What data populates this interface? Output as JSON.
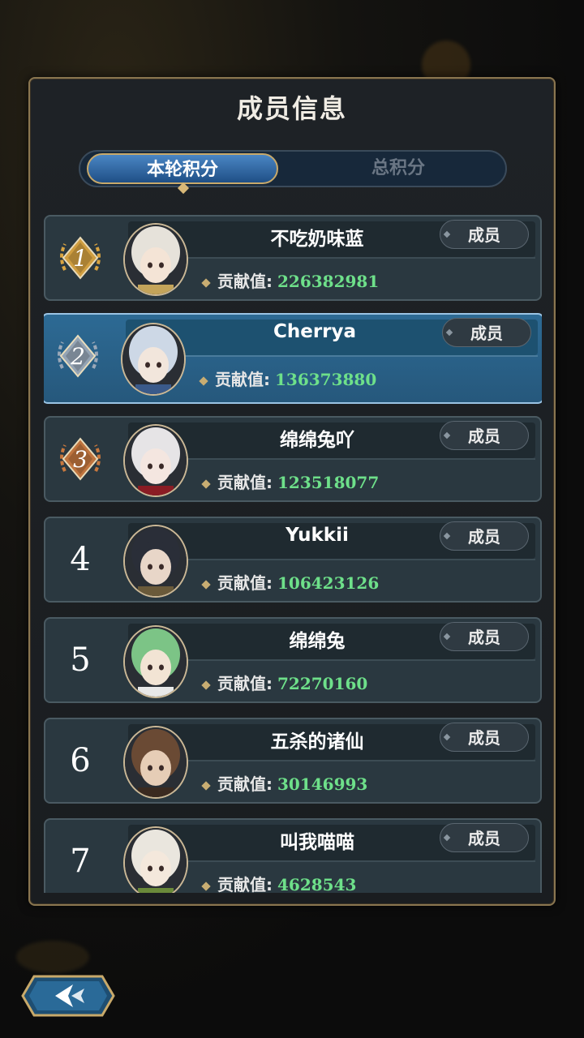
{
  "title": "成员信息",
  "tabs": [
    {
      "label": "本轮积分",
      "active": true
    },
    {
      "label": "总积分",
      "active": false
    }
  ],
  "contrib_label": "贡献值:",
  "members": [
    {
      "rank": "1",
      "name": "不吃奶味蓝",
      "role": "成员",
      "contribution": "226382981",
      "medal": "gold",
      "hair": "#e6e2da",
      "skin": "#f4e4d6",
      "accent": "#c4a45a"
    },
    {
      "rank": "2",
      "name": "Cherrya",
      "role": "成员",
      "contribution": "136373880",
      "medal": "silver",
      "hair": "#cdd8e6",
      "skin": "#f2e6dc",
      "accent": "#3a5a8a"
    },
    {
      "rank": "3",
      "name": "绵绵兔吖",
      "role": "成员",
      "contribution": "123518077",
      "medal": "bronze",
      "hair": "#e6e4e6",
      "skin": "#f4e6e0",
      "accent": "#8a1c24"
    },
    {
      "rank": "4",
      "name": "Yukkii",
      "role": "成员",
      "contribution": "106423126",
      "medal": "none",
      "hair": "#2a2e38",
      "skin": "#e8d6c8",
      "accent": "#6a5a3a"
    },
    {
      "rank": "5",
      "name": "绵绵兔",
      "role": "成员",
      "contribution": "72270160",
      "medal": "none",
      "hair": "#7cc486",
      "skin": "#f2e4d4",
      "accent": "#e8e8e8"
    },
    {
      "rank": "6",
      "name": "五杀的诸仙",
      "role": "成员",
      "contribution": "30146993",
      "medal": "none",
      "hair": "#6a4a34",
      "skin": "#e6cdb6",
      "accent": "#3a2a20"
    },
    {
      "rank": "7",
      "name": "叫我喵喵",
      "role": "成员",
      "contribution": "4628543",
      "medal": "none",
      "hair": "#eae6de",
      "skin": "#f4e8dc",
      "accent": "#6a8a3a"
    }
  ],
  "colors": {
    "gold": "#d9a441",
    "silver": "#9aa8b8",
    "bronze": "#c8783e",
    "contribution_value": "#6ee08a",
    "frame": "#8a7650"
  }
}
